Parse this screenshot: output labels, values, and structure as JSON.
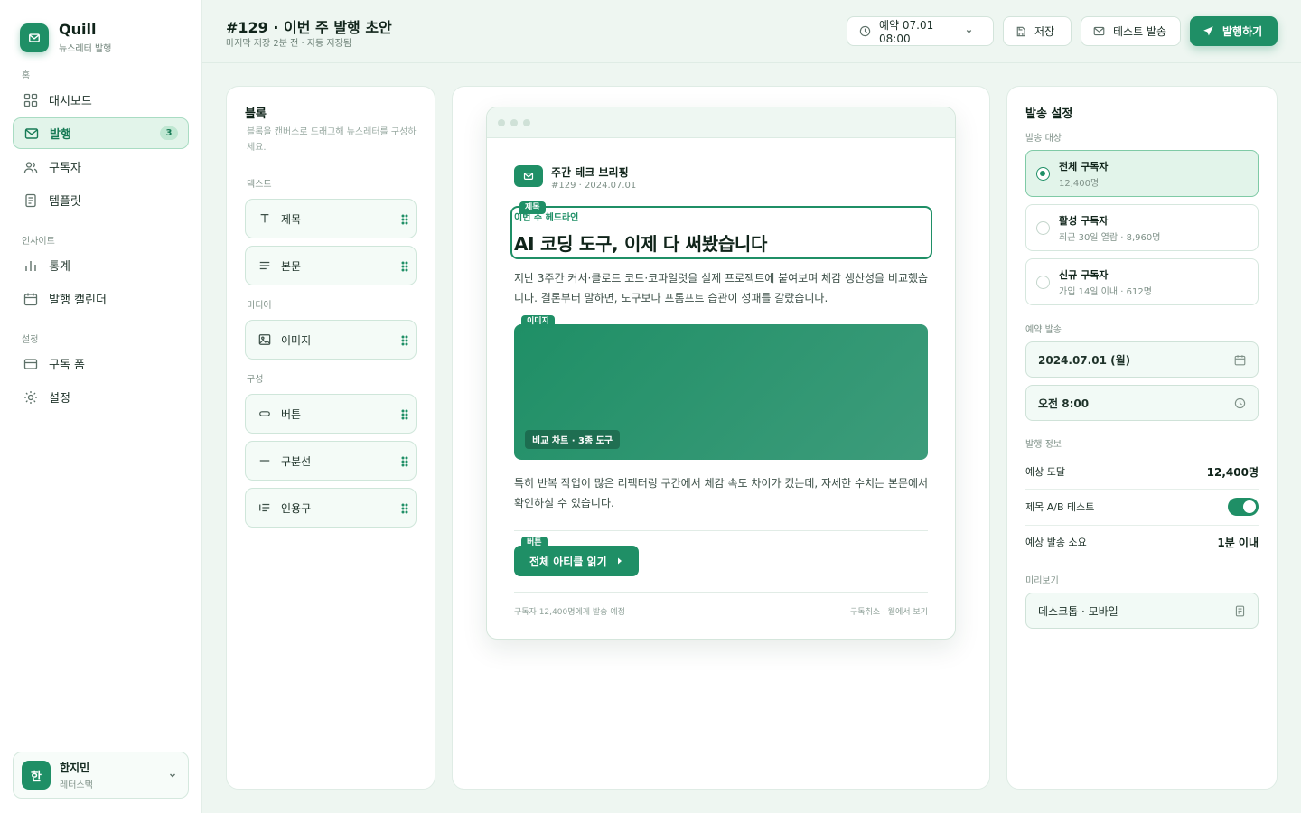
{
  "app": {
    "name": "Quill",
    "subtitle": "뉴스레터 발행"
  },
  "sidebar": {
    "sections": [
      {
        "title": "홈",
        "items": [
          {
            "label": "대시보드",
            "icon": "grid-icon"
          },
          {
            "label": "발행",
            "icon": "mail-icon",
            "active": true,
            "badge": "3"
          },
          {
            "label": "구독자",
            "icon": "users-icon"
          },
          {
            "label": "템플릿",
            "icon": "file-icon"
          }
        ]
      },
      {
        "title": "인사이트",
        "items": [
          {
            "label": "통계",
            "icon": "bar-chart-icon"
          },
          {
            "label": "발행 캘린더",
            "icon": "calendar-icon"
          }
        ]
      },
      {
        "title": "설정",
        "items": [
          {
            "label": "구독 폼",
            "icon": "form-icon"
          },
          {
            "label": "설정",
            "icon": "gear-icon"
          }
        ]
      }
    ],
    "user": {
      "initial": "한",
      "name": "한지민",
      "role": "레터스택"
    }
  },
  "header": {
    "title": "#129 · 이번 주 발행 초안",
    "subtitle": "마지막 저장 2분 전 · 자동 저장됨",
    "schedule_label": "예약 07.01 08:00",
    "save_label": "저장",
    "test_label": "테스트 발송",
    "publish_label": "발행하기"
  },
  "blocks": {
    "title": "블록",
    "description": "블록을 캔버스로 드래그해 뉴스레터를 구성하세요.",
    "groups": [
      {
        "label": "텍스트",
        "items": [
          {
            "label": "제목",
            "icon": "text-icon"
          },
          {
            "label": "본문",
            "icon": "paragraph-icon"
          }
        ]
      },
      {
        "label": "미디어",
        "items": [
          {
            "label": "이미지",
            "icon": "image-icon"
          }
        ]
      },
      {
        "label": "구성",
        "items": [
          {
            "label": "버튼",
            "icon": "button-icon"
          },
          {
            "label": "구분선",
            "icon": "divider-icon"
          },
          {
            "label": "인용구",
            "icon": "quote-icon"
          }
        ]
      }
    ]
  },
  "canvas": {
    "brand": "주간 테크 브리핑",
    "issue": "#129 · 2024.07.01",
    "title_tag": "제목",
    "kicker": "이번 주 헤드라인",
    "headline": "AI 코딩 도구, 이제 다 써봤습니다",
    "intro": "지난 3주간 커서·클로드 코드·코파일럿을 실제 프로젝트에 붙여보며 체감 생산성을 비교했습니다. 결론부터 말하면, 도구보다 프롬프트 습관이 성패를 갈랐습니다.",
    "image_tag": "이미지",
    "image_caption": "비교 차트 · 3종 도구",
    "body": "특히 반복 작업이 많은 리팩터링 구간에서 체감 속도 차이가 컸는데, 자세한 수치는 본문에서 확인하실 수 있습니다.",
    "button_tag": "버튼",
    "cta_label": "전체 아티클 읽기",
    "footer_left": "구독자 12,400명에게 발송 예정",
    "footer_right": "구독취소 · 웹에서 보기"
  },
  "send": {
    "title": "발송 설정",
    "audience_label": "발송 대상",
    "audiences": [
      {
        "name": "전체 구독자",
        "desc": "12,400명",
        "selected": true
      },
      {
        "name": "활성 구독자",
        "desc": "최근 30일 열람 · 8,960명",
        "selected": false
      },
      {
        "name": "신규 구독자",
        "desc": "가입 14일 이내 · 612명",
        "selected": false
      }
    ],
    "schedule_label": "예약 발송",
    "date": "2024.07.01 (월)",
    "time": "오전 8:00",
    "info_label": "발행 정보",
    "reach_label": "예상 도달",
    "reach_value": "12,400명",
    "ab_label": "제목 A/B 테스트",
    "ab_enabled": true,
    "duration_label": "예상 발송 소요",
    "duration_value": "1분 이내",
    "preview_label": "미리보기",
    "preview_value": "데스크톱 · 모바일"
  },
  "colors": {
    "accent": "#1f8f66",
    "background": "#eef6f1"
  }
}
